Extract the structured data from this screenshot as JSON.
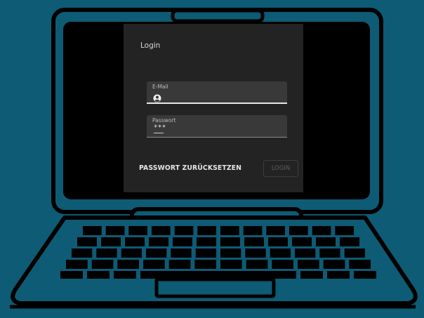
{
  "login": {
    "title": "Login",
    "email": {
      "label": "E-Mail",
      "value": "",
      "icon": "account-circle-icon"
    },
    "password": {
      "label": "Passwort",
      "value": "***"
    },
    "reset_label": "PASSWORT ZURÜCKSETZEN",
    "login_label": "LOGIN"
  },
  "colors": {
    "background": "#0e5b75",
    "screen": "#000000",
    "panel": "#232323",
    "field": "#393939",
    "text": "#e6e6e6",
    "disabled": "#5e5e5e"
  }
}
